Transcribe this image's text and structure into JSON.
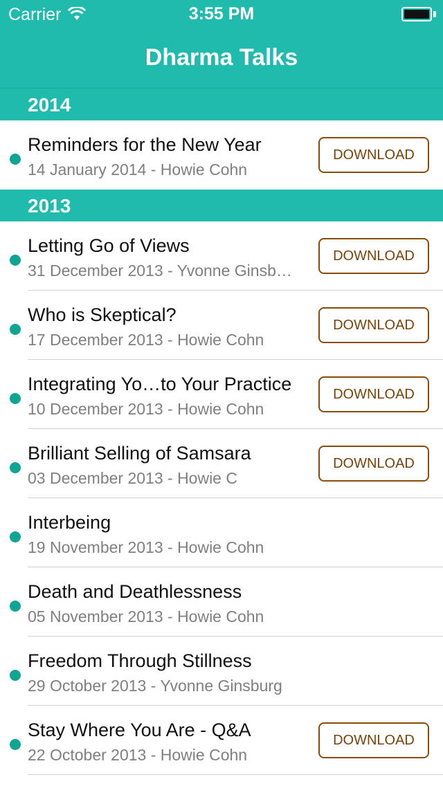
{
  "status_bar": {
    "carrier": "Carrier",
    "time": "3:55 PM"
  },
  "nav": {
    "title": "Dharma Talks"
  },
  "colors": {
    "accent": "#1fbcad",
    "dot": "#0fa594",
    "download": "#7a4208"
  },
  "sections": [
    {
      "year": "2014",
      "talks": [
        {
          "title": "Reminders for the New Year",
          "subtitle": "14 January 2014 - Howie Cohn",
          "download_label": "DOWNLOAD"
        }
      ]
    },
    {
      "year": "2013",
      "talks": [
        {
          "title": "Letting Go of Views",
          "subtitle": "31 December 2013 - Yvonne Ginsb…",
          "download_label": "DOWNLOAD"
        },
        {
          "title": "Who is Skeptical?",
          "subtitle": "17 December 2013 - Howie Cohn",
          "download_label": "DOWNLOAD"
        },
        {
          "title": "Integrating Yo…to Your Practice",
          "subtitle": "10 December 2013 - Howie Cohn",
          "download_label": "DOWNLOAD"
        },
        {
          "title": "Brilliant Selling of Samsara",
          "subtitle": "03 December 2013 - Howie C",
          "download_label": "DOWNLOAD"
        },
        {
          "title": "Interbeing",
          "subtitle": "19 November 2013 - Howie Cohn",
          "download_label": ""
        },
        {
          "title": "Death and Deathlessness",
          "subtitle": "05 November 2013 - Howie Cohn",
          "download_label": ""
        },
        {
          "title": "Freedom Through Stillness",
          "subtitle": "29 October 2013 - Yvonne Ginsburg",
          "download_label": ""
        },
        {
          "title": "Stay Where You Are - Q&A",
          "subtitle": "22 October 2013 - Howie Cohn",
          "download_label": "DOWNLOAD"
        }
      ]
    }
  ]
}
